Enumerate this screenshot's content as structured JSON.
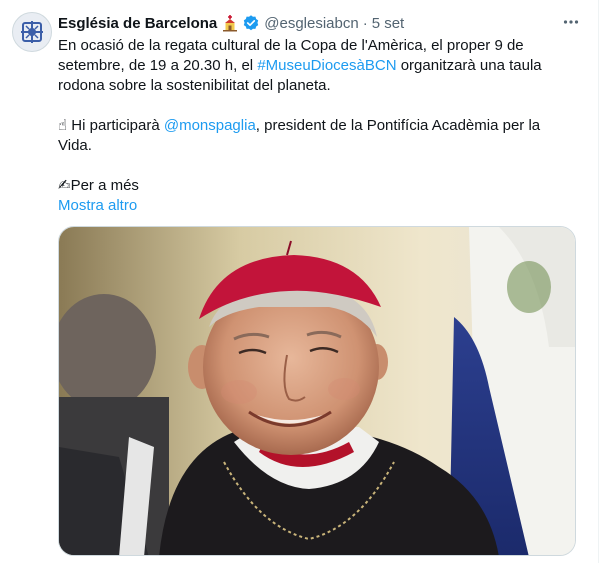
{
  "account": {
    "name": "Església de Barcelona",
    "handle": "@esglesiabcn",
    "separator": "·",
    "date": "5 set"
  },
  "tweet": {
    "line1_prefix": "En ocasió de la regata cultural de la Copa de l'Amèrica, el proper 9 de",
    "line2_prefix": "setembre, de 19 a 20.30 h, el ",
    "hashtag": "#MuseuDiocesàBCN",
    "line2_suffix": " organitzarà una taula",
    "line3": "rodona sobre la sostenibilitat del planeta.",
    "line4_prefix": "☝ Hi participarà ",
    "mention": "@monspaglia",
    "line4_suffix": ", president de la Pontifícia Acadèmia per la",
    "line5": "Vida.",
    "line6": "✍Per a més",
    "show_more": "Mostra altro"
  },
  "icons": {
    "emoji": "church-icon",
    "verified": "verified-badge-icon",
    "more": "more-options-icon",
    "avatar": "diocese-logo-icon"
  },
  "colors": {
    "link": "#1d9bf0",
    "text": "#0f1419",
    "secondary": "#536471"
  }
}
